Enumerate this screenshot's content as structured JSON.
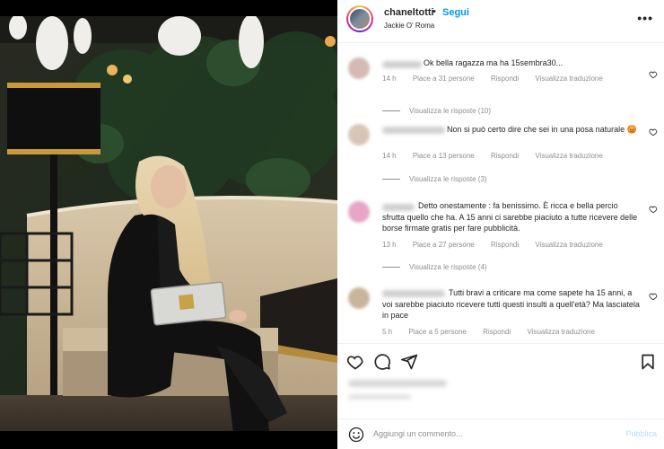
{
  "post": {
    "username": "chaneltotti",
    "separator": "•",
    "follow_label": "Segui",
    "location": "Jackie O' Roma",
    "more_icon": "more-options-icon"
  },
  "comments": [
    {
      "text": "Ok bella ragazza ma ha 15sembra30...",
      "time": "14 h",
      "likes": "Piace a 31 persone",
      "reply": "Rispondi",
      "translate": "Visualizza traduzione",
      "view_replies": "Visualizza le risposte (10)"
    },
    {
      "text": "Non si può certo dire che sei in una posa naturale 😡",
      "time": "14 h",
      "likes": "Piace a 13 persone",
      "reply": "Rispondi",
      "translate": "Visualizza traduzione",
      "view_replies": "Visualizza le risposte (3)"
    },
    {
      "text": "Detto onestamente : fa benissimo. È ricca e bella percio sfrutta quello che ha. A 15 anni ci sarebbe piaciuto a tutte ricevere delle borse firmate gratis per fare pubblicità.",
      "time": "13 h",
      "likes": "Piace a 27 persone",
      "reply": "Rispondi",
      "translate": "Visualizza traduzione",
      "view_replies": "Visualizza le risposte (4)"
    },
    {
      "text": "Tutti bravi a criticare ma come sapete ha 15 anni, a voi sarebbe piaciuto ricevere tutti questi insulti a quell'età? Ma lasciatela in pace",
      "time": "5 h",
      "likes": "Piace a 5 persone",
      "reply": "Rispondi",
      "translate": "Visualizza traduzione"
    }
  ],
  "actions": {
    "like": "heart-icon",
    "comment": "comment-icon",
    "share": "share-icon",
    "save": "bookmark-icon"
  },
  "add_comment": {
    "placeholder": "Aggiungi un commento...",
    "publish_label": "Pubblica"
  },
  "colors": {
    "accent": "#0095f6",
    "publish_disabled": "#b2dffc",
    "secondary_text": "#8e8e8e"
  }
}
